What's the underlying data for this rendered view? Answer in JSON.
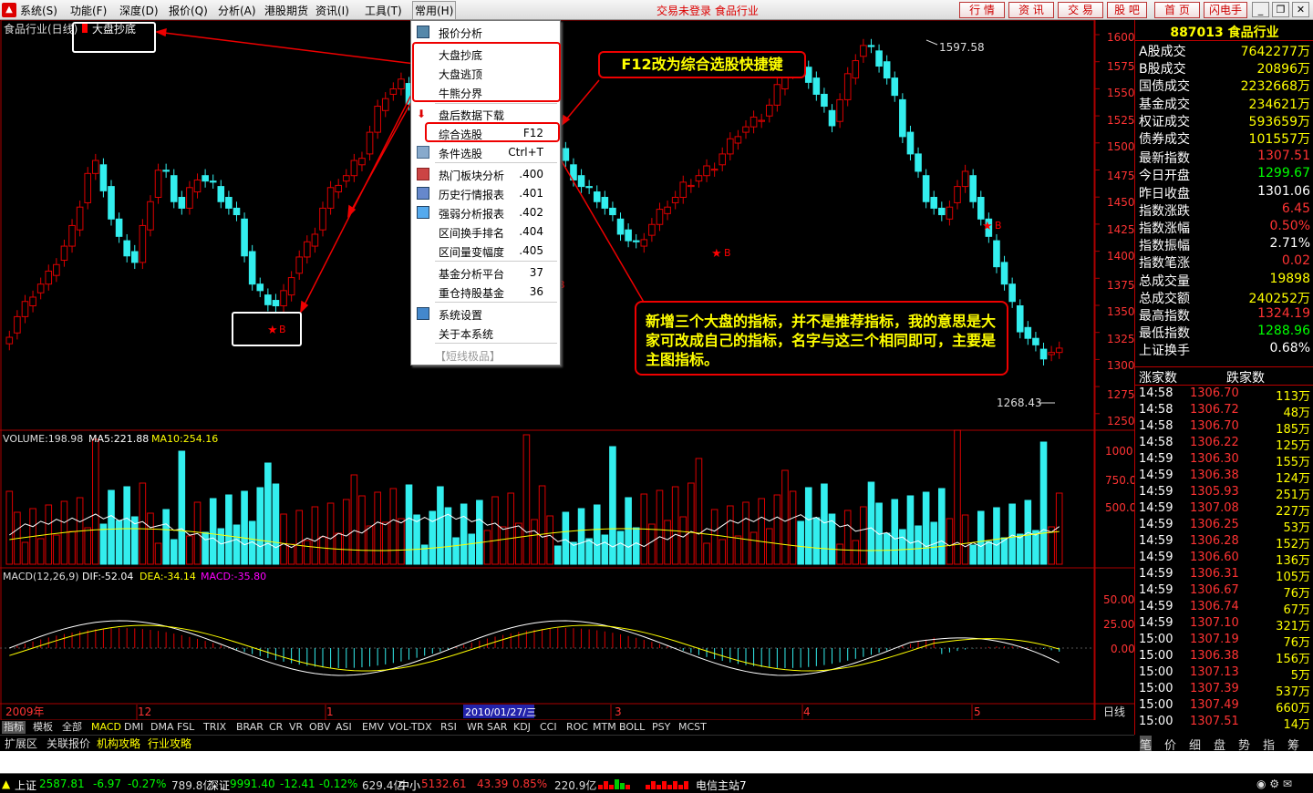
{
  "menubar": {
    "items": [
      {
        "label": "系统(S)"
      },
      {
        "label": "功能(F)"
      },
      {
        "label": "深度(D)"
      },
      {
        "label": "报价(Q)"
      },
      {
        "label": "分析(A)"
      },
      {
        "label": "港股期货"
      },
      {
        "label": "资讯(I)"
      },
      {
        "label": "工具(T)"
      },
      {
        "label": "常用(H)"
      }
    ],
    "title": "交易未登录  食品行业",
    "buttons": [
      "行 情",
      "资 讯",
      "交 易",
      "股 吧",
      "首 页",
      "闪电手"
    ]
  },
  "chart": {
    "main_label": "食品行业(日线)",
    "indicator_label": "大盘抄底",
    "price_ticks": [
      "1600",
      "1575",
      "1550",
      "1525",
      "1500",
      "1475",
      "1450",
      "1425",
      "1400",
      "1375",
      "1350",
      "1325",
      "1300",
      "1275",
      "1250"
    ],
    "high_marker": "1597.58",
    "low_marker": "1268.43",
    "buy_mark": "B",
    "volume_label": "VOLUME:198.98",
    "ma5_label": "MA5:221.88",
    "ma10_label": "MA10:254.16",
    "volume_ticks": [
      "1000",
      "750.0",
      "500.0"
    ],
    "macd_label": "MACD(12,26,9)",
    "dif_label": "DIF:-52.04",
    "dea_label": "DEA:-34.14",
    "macd_val_label": "MACD:-35.80",
    "macd_ticks": [
      "50.00",
      "25.00",
      "0.00"
    ],
    "date_labels": [
      "2009年",
      "12",
      "1",
      "2010/01/27/三",
      "3",
      "4",
      "5"
    ],
    "period_label": "日线"
  },
  "dropdown": {
    "items": [
      {
        "label": "报价分析",
        "shortcut": ""
      },
      {
        "label": "大盘抄底",
        "shortcut": ""
      },
      {
        "label": "大盘逃顶",
        "shortcut": ""
      },
      {
        "label": "牛熊分界",
        "shortcut": ""
      },
      {
        "label": "盘后数据下载",
        "shortcut": ""
      },
      {
        "label": "综合选股",
        "shortcut": "F12"
      },
      {
        "label": "条件选股",
        "shortcut": "Ctrl+T"
      },
      {
        "label": "热门板块分析",
        "shortcut": ".400"
      },
      {
        "label": "历史行情报表",
        "shortcut": ".401"
      },
      {
        "label": "强弱分析报表",
        "shortcut": ".402"
      },
      {
        "label": "区间换手排名",
        "shortcut": ".404"
      },
      {
        "label": "区间量变幅度",
        "shortcut": ".405"
      },
      {
        "label": "基金分析平台",
        "shortcut": "37"
      },
      {
        "label": "重仓持股基金",
        "shortcut": "36"
      },
      {
        "label": "系统设置",
        "shortcut": ""
      },
      {
        "label": "关于本系统",
        "shortcut": ""
      },
      {
        "label": "【短线极品】",
        "shortcut": ""
      }
    ]
  },
  "annotations": {
    "callout1": "F12改为综合选股快捷键",
    "callout2": "新增三个大盘的指标，并不是推荐指标，我的意思是大家可改成自己的指标，名字与这三个相同即可，主要是主图指标。"
  },
  "panel": {
    "title": "887013 食品行业",
    "rows": [
      {
        "k": "A股成交",
        "v": "7642277万",
        "c": "#ff0"
      },
      {
        "k": "B股成交",
        "v": "20896万",
        "c": "#ff0"
      },
      {
        "k": "国债成交",
        "v": "2232668万",
        "c": "#ff0"
      },
      {
        "k": "基金成交",
        "v": "234621万",
        "c": "#ff0"
      },
      {
        "k": "权证成交",
        "v": "593659万",
        "c": "#ff0"
      },
      {
        "k": "债券成交",
        "v": "101557万",
        "c": "#ff0"
      },
      {
        "k": "最新指数",
        "v": "1307.51",
        "c": "#f33"
      },
      {
        "k": "今日开盘",
        "v": "1299.67",
        "c": "#0f0"
      },
      {
        "k": "昨日收盘",
        "v": "1301.06",
        "c": "#fff"
      },
      {
        "k": "指数涨跌",
        "v": "6.45",
        "c": "#f33"
      },
      {
        "k": "指数涨幅",
        "v": "0.50%",
        "c": "#f33"
      },
      {
        "k": "指数振幅",
        "v": "2.71%",
        "c": "#fff"
      },
      {
        "k": "指数笔涨",
        "v": "0.02",
        "c": "#f33"
      },
      {
        "k": "总成交量",
        "v": "19898",
        "c": "#ff0"
      },
      {
        "k": "总成交额",
        "v": "240252万",
        "c": "#ff0"
      },
      {
        "k": "最高指数",
        "v": "1324.19",
        "c": "#f33"
      },
      {
        "k": "最低指数",
        "v": "1288.96",
        "c": "#0f0"
      },
      {
        "k": "上证换手",
        "v": "0.68%",
        "c": "#fff"
      }
    ],
    "rise_label": "涨家数",
    "fall_label": "跌家数",
    "ticks": [
      [
        "14:58",
        "1306.70",
        "113万"
      ],
      [
        "14:58",
        "1306.72",
        "48万"
      ],
      [
        "14:58",
        "1306.70",
        "185万"
      ],
      [
        "14:58",
        "1306.22",
        "125万"
      ],
      [
        "14:59",
        "1306.30",
        "155万"
      ],
      [
        "14:59",
        "1306.38",
        "124万"
      ],
      [
        "14:59",
        "1305.93",
        "251万"
      ],
      [
        "14:59",
        "1307.08",
        "227万"
      ],
      [
        "14:59",
        "1306.25",
        "53万"
      ],
      [
        "14:59",
        "1306.28",
        "152万"
      ],
      [
        "14:59",
        "1306.60",
        "136万"
      ],
      [
        "14:59",
        "1306.31",
        "105万"
      ],
      [
        "14:59",
        "1306.67",
        "76万"
      ],
      [
        "14:59",
        "1306.74",
        "67万"
      ],
      [
        "14:59",
        "1307.10",
        "321万"
      ],
      [
        "15:00",
        "1307.19",
        "76万"
      ],
      [
        "15:00",
        "1306.38",
        "156万"
      ],
      [
        "15:00",
        "1307.13",
        "5万"
      ],
      [
        "15:00",
        "1307.39",
        "537万"
      ],
      [
        "15:00",
        "1307.49",
        "660万"
      ],
      [
        "15:00",
        "1307.51",
        "14万"
      ]
    ],
    "bottom_tabs": [
      "笔",
      "价",
      "细",
      "盘",
      "势",
      "指",
      "筹"
    ]
  },
  "indicator_tabs": [
    "指标",
    "模板",
    "全部",
    "MACD",
    "DMI",
    "DMA",
    "FSL",
    "TRIX",
    "BRAR",
    "CR",
    "VR",
    "OBV",
    "ASI",
    "EMV",
    "VOL-TDX",
    "RSI",
    "WR",
    "SAR",
    "KDJ",
    "CCI",
    "ROC",
    "MTM",
    "BOLL",
    "PSY",
    "MCST"
  ],
  "bottom_tabs": [
    "扩展区",
    "关联报价",
    "机构攻略",
    "行业攻略"
  ],
  "status": {
    "sh_name": "上证",
    "sh_val": "2587.81",
    "sh_chg": "-6.97",
    "sh_pct": "-0.27%",
    "sh_amt": "789.8亿",
    "sz_name": "深证",
    "sz_val": "9991.40",
    "sz_chg": "-12.41",
    "sz_pct": "-0.12%",
    "sz_amt": "629.4亿",
    "zx_name": "中小",
    "zx_val": "5132.61",
    "zx_chg": "43.39",
    "zx_pct": "0.85%",
    "zx_amt": "220.9亿",
    "server": "电信主站7"
  }
}
